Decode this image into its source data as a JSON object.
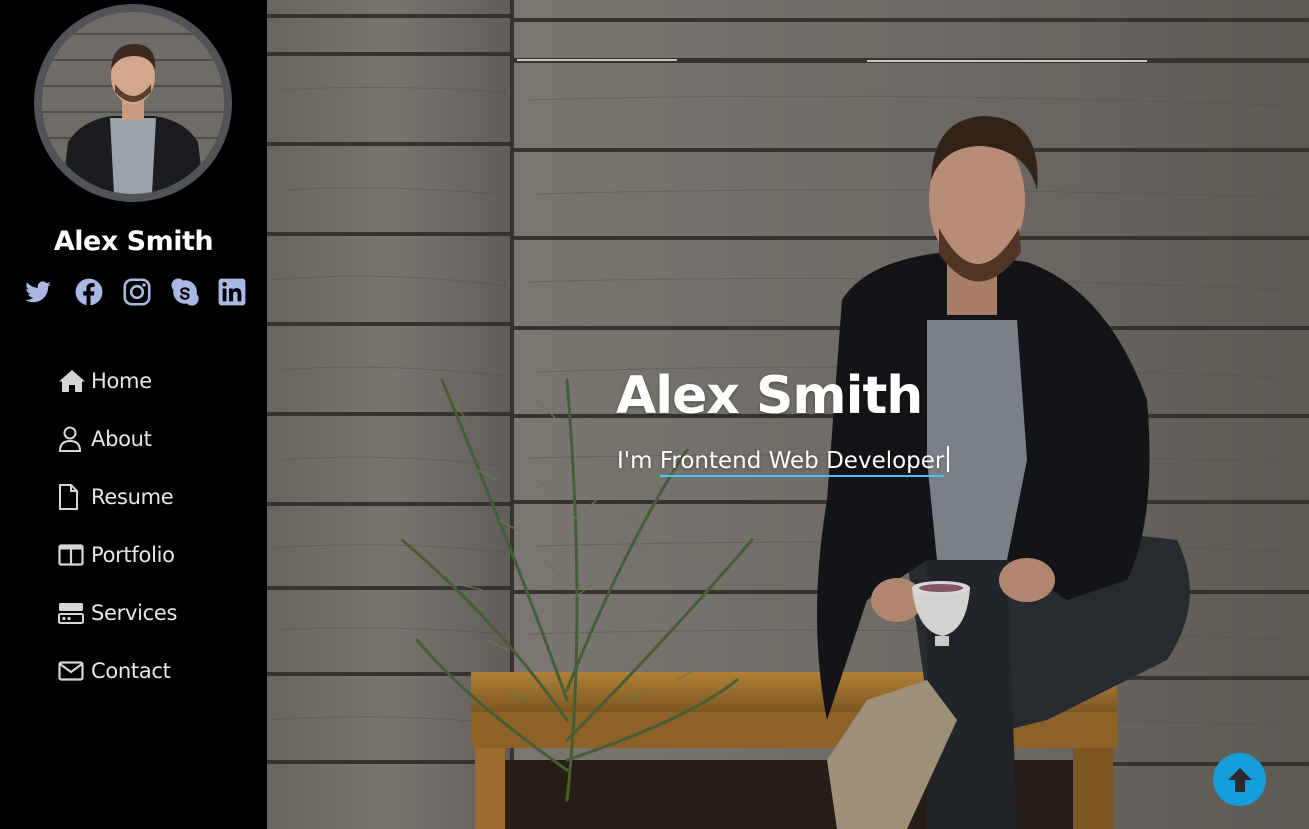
{
  "sidebar": {
    "name": "Alex Smith",
    "social": [
      {
        "icon": "twitter-icon"
      },
      {
        "icon": "facebook-icon"
      },
      {
        "icon": "instagram-icon"
      },
      {
        "icon": "skype-icon"
      },
      {
        "icon": "linkedin-icon"
      }
    ],
    "nav": [
      {
        "label": "Home",
        "icon": "home-icon"
      },
      {
        "label": "About",
        "icon": "person-icon"
      },
      {
        "label": "Resume",
        "icon": "file-icon"
      },
      {
        "label": "Portfolio",
        "icon": "book-icon"
      },
      {
        "label": "Services",
        "icon": "server-icon"
      },
      {
        "label": "Contact",
        "icon": "envelope-icon"
      }
    ]
  },
  "hero": {
    "title": "Alex Smith",
    "prefix": "I'm ",
    "typed": "Frontend Web Developer"
  },
  "colors": {
    "sidebar_bg": "#000000",
    "accent": "#149ddd",
    "social_icon": "#a8b9e3"
  }
}
